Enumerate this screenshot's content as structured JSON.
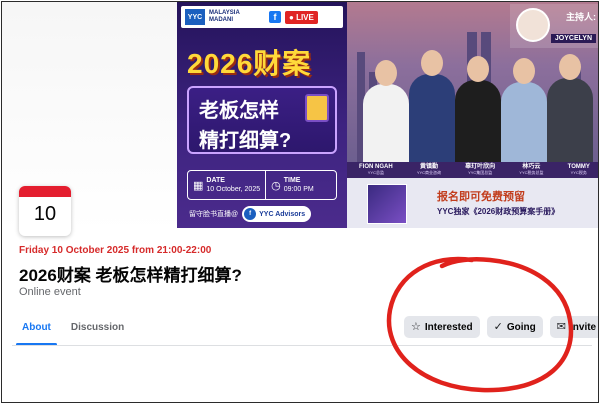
{
  "banner": {
    "logo_text": "YYC",
    "madani_text": "MALAYSIA MADANI",
    "live_label": "LIVE",
    "fb_letter": "f",
    "headline_year": "2026财案",
    "headline_line1": "老板怎样",
    "headline_line2": "精打细算?",
    "date_label": "DATE",
    "date_value": "10 October, 2025",
    "time_label": "TIME",
    "time_value": "09:00 PM",
    "follow_text": "留守脸书直播@",
    "page_name": "YYC Advisors",
    "host_label": "主持人:",
    "host_name": "JOYCELYN",
    "speakers": [
      {
        "name": "FION NGAH",
        "role": "YYC总监"
      },
      {
        "name": "黄镇勤",
        "role": "YYC商业咨询"
      },
      {
        "name": "辜玎叶欣向",
        "role": "YYC集团总监"
      },
      {
        "name": "林巧云",
        "role": "YYC税务总监"
      },
      {
        "name": "TOMMY",
        "role": "YYC税务"
      }
    ],
    "promo_line1": "报名即可免费预留",
    "promo_line2": "YYC独家《2026财政预算案手册》"
  },
  "event": {
    "day": "10",
    "time_text": "Friday 10 October 2025 from 21:00-22:00",
    "title": "2026财案 老板怎样精打细算?",
    "type": "Online event"
  },
  "tabs": [
    {
      "label": "About",
      "active": true
    },
    {
      "label": "Discussion",
      "active": false
    }
  ],
  "actions": {
    "interested": "Interested",
    "going": "Going",
    "invite": "Invite"
  },
  "colors": {
    "accent": "#1877f2",
    "date_red": "#e41e2f",
    "annotation_red": "#e0221c"
  }
}
